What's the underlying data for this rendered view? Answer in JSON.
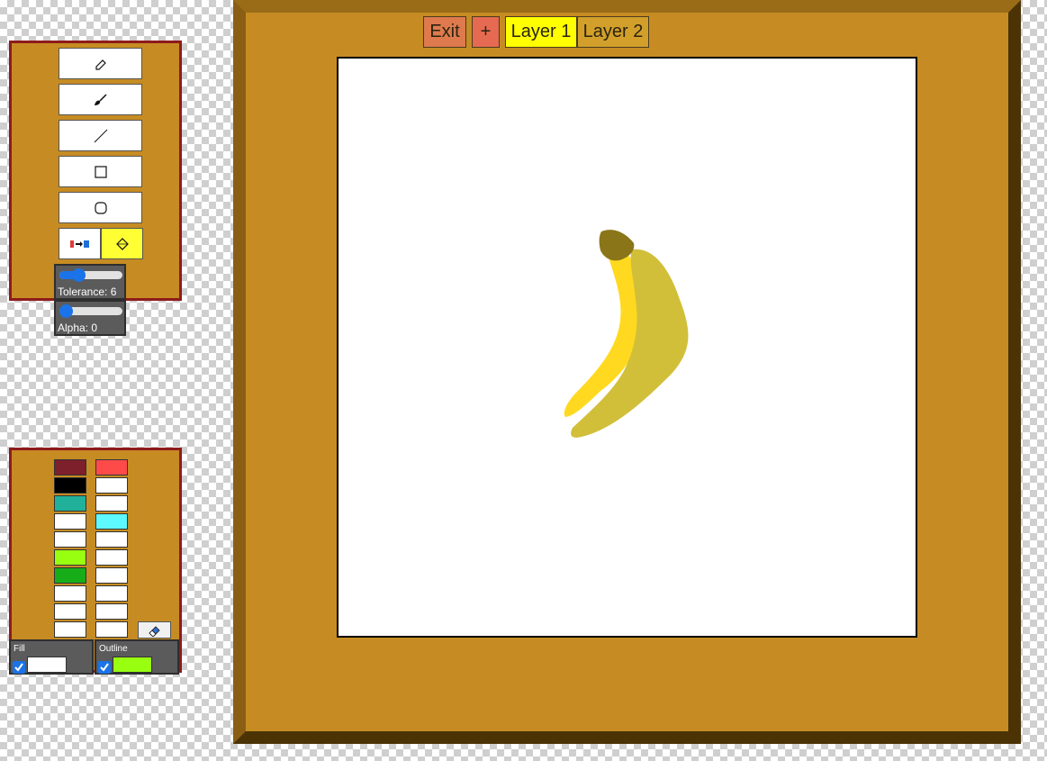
{
  "topbar": {
    "exit_label": "Exit",
    "add_label": "+",
    "layers": [
      {
        "label": "Layer 1",
        "active": true
      },
      {
        "label": "Layer 2",
        "active": false
      }
    ]
  },
  "tools": [
    {
      "name": "pencil-icon"
    },
    {
      "name": "brush-icon"
    },
    {
      "name": "line-icon"
    },
    {
      "name": "rectangle-icon"
    },
    {
      "name": "ellipse-icon"
    },
    {
      "name": "color-transfer-icon"
    },
    {
      "name": "fill-bucket-icon",
      "active": true
    }
  ],
  "sliders": {
    "tolerance": {
      "label": "Tolerance: 6",
      "value": 6,
      "max": 20
    },
    "alpha": {
      "label": "Alpha: 0",
      "value": 0,
      "max": 100
    }
  },
  "palette": {
    "left_column": [
      "#7e1f2c",
      "#000000",
      "#21b19a",
      "#ffffff",
      "#ffffff",
      "#99ff11",
      "#17ad19",
      "#ffffff",
      "#ffffff",
      "#ffffff"
    ],
    "right_column": [
      "#ff4a4a",
      "#ffffff",
      "#ffffff",
      "#5ef8ff",
      "#ffffff",
      "#ffffff",
      "#ffffff",
      "#ffffff",
      "#ffffff",
      "#ffffff"
    ],
    "eraser_icon": "eraser-icon"
  },
  "fill": {
    "label": "Fill",
    "checked": true,
    "color": "#ffffff"
  },
  "outline": {
    "label": "Outline",
    "checked": true,
    "color": "#99ff11"
  },
  "colors": {
    "panel": "#c68c23",
    "panel_border": "#8e1b1b",
    "active_tool": "#ffff33",
    "exit_button": "#de7a4d",
    "add_button": "#e56a51",
    "layer_active": "#ffff00",
    "layer_inactive": "#d2a02a",
    "banana_light": "#ffd920",
    "banana_dark": "#d1bf3a",
    "banana_stem": "#8a7619"
  }
}
